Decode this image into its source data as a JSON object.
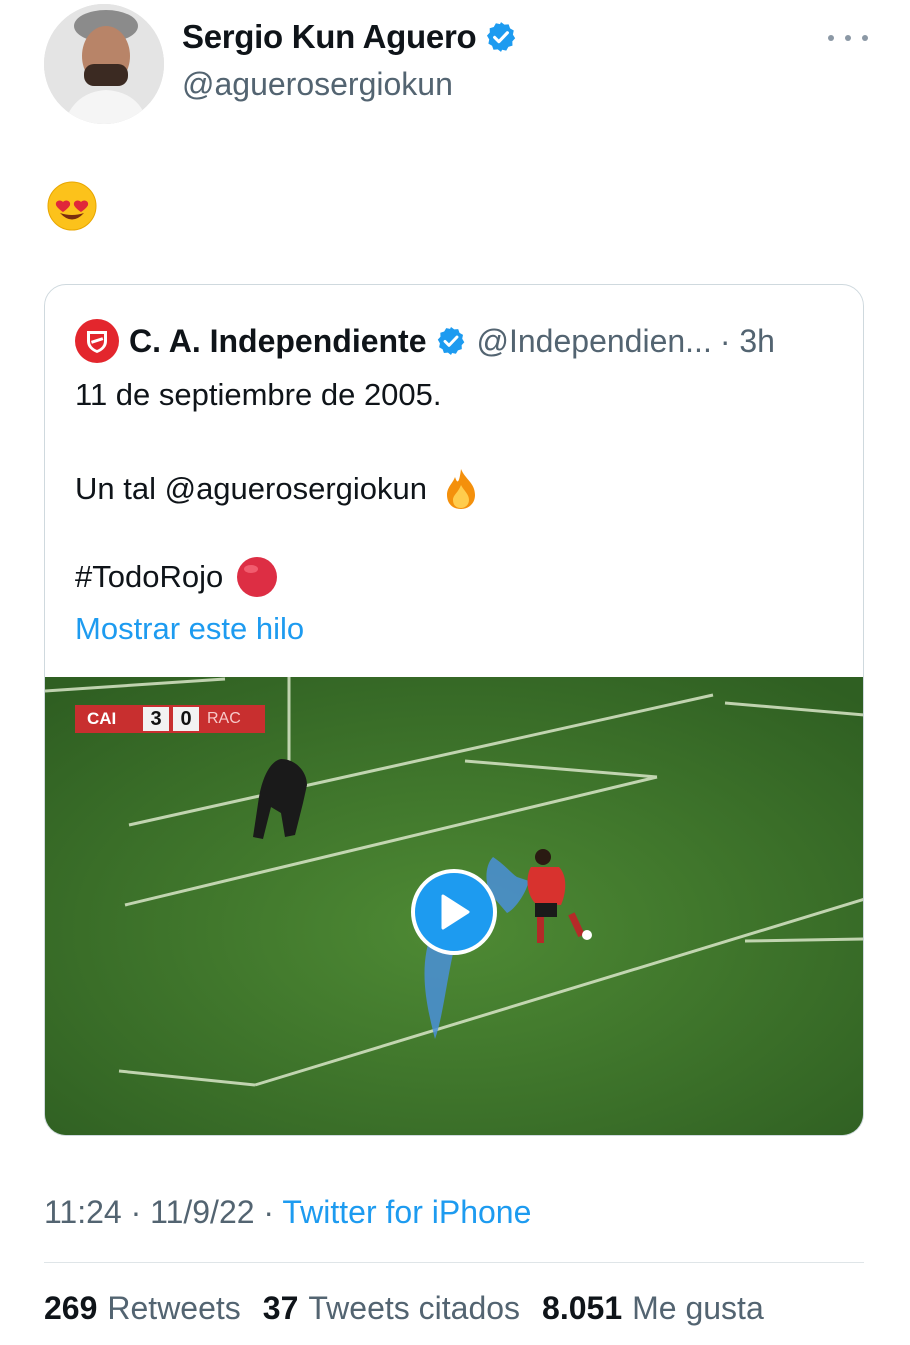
{
  "tweet": {
    "author_name": "Sergio Kun Aguero",
    "author_handle": "@aguerosergiokun",
    "verified_color": "#1d9bf0",
    "body_emoji": "smiling-face-with-heart-eyes"
  },
  "quote": {
    "author_name": "C. A. Independiente",
    "author_handle": "@Independien...",
    "time": "· 3h",
    "line1": "11 de septiembre de 2005.",
    "line2": "Un tal @aguerosergiokun",
    "line2_emoji": "fire",
    "line3": "#TodoRojo",
    "line3_emoji": "red-circle",
    "show_thread": "Mostrar este hilo",
    "video": {
      "score_home": "CAI",
      "score_home_goals": "3",
      "score_away_goals": "0",
      "score_away": "RAC",
      "play_icon": "play-icon"
    }
  },
  "footer": {
    "time": "11:24",
    "date": "11/9/22",
    "separator": "·",
    "source": "Twitter for iPhone"
  },
  "stats": {
    "retweets_count": "269",
    "retweets_label": "Retweets",
    "quotes_count": "37",
    "quotes_label": "Tweets citados",
    "likes_count": "8.051",
    "likes_label": "Me gusta"
  },
  "colors": {
    "accent": "#1d9bf0",
    "text": "#0f1419",
    "secondary": "#536471",
    "club_red": "#e3262d",
    "pitch": "#3f7a2b"
  }
}
